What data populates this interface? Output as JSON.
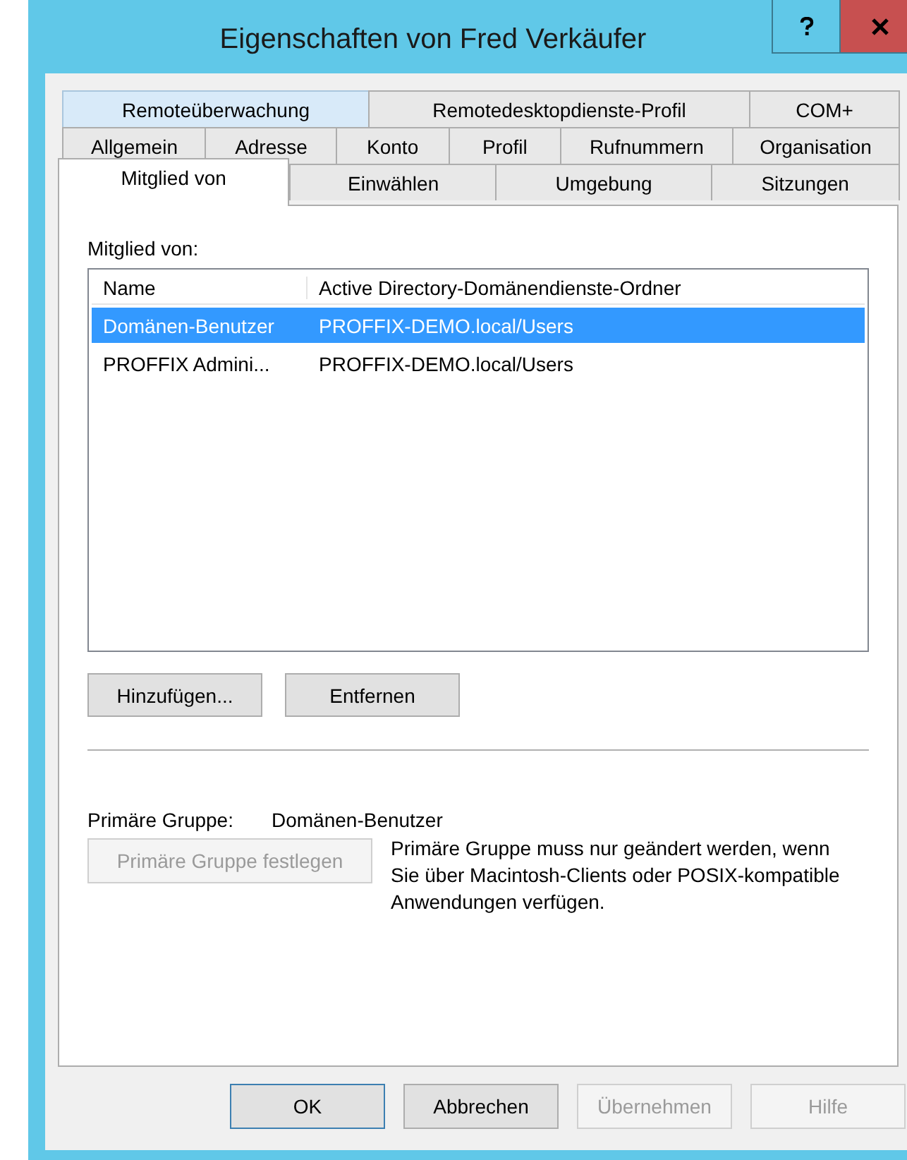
{
  "window": {
    "title": "Eigenschaften von Fred Verkäufer"
  },
  "tab_rows": [
    [
      {
        "label": "Remoteüberwachung",
        "selected": false,
        "highlighted": true
      },
      {
        "label": "Remotedesktopdienste-Profil",
        "selected": false,
        "highlighted": false
      },
      {
        "label": "COM+",
        "selected": false,
        "highlighted": false
      }
    ],
    [
      {
        "label": "Allgemein",
        "selected": false,
        "highlighted": false
      },
      {
        "label": "Adresse",
        "selected": false,
        "highlighted": false
      },
      {
        "label": "Konto",
        "selected": false,
        "highlighted": false
      },
      {
        "label": "Profil",
        "selected": false,
        "highlighted": false
      },
      {
        "label": "Rufnummern",
        "selected": false,
        "highlighted": false
      },
      {
        "label": "Organisation",
        "selected": false,
        "highlighted": false
      }
    ],
    [
      {
        "label": "Mitglied von",
        "selected": true,
        "highlighted": false
      },
      {
        "label": "Einwählen",
        "selected": false,
        "highlighted": false
      },
      {
        "label": "Umgebung",
        "selected": false,
        "highlighted": false
      },
      {
        "label": "Sitzungen",
        "selected": false,
        "highlighted": false
      }
    ]
  ],
  "member_label": "Mitglied von:",
  "table": {
    "columns": [
      "Name",
      "Active Directory-Domänendienste-Ordner"
    ],
    "rows": [
      {
        "cells": [
          "Domänen-Benutzer",
          "PROFFIX-DEMO.local/Users"
        ],
        "selected": true
      },
      {
        "cells": [
          "PROFFIX Admini...",
          "PROFFIX-DEMO.local/Users"
        ],
        "selected": false
      }
    ]
  },
  "list_buttons": [
    {
      "label": "Hinzufügen...",
      "disabled": false
    },
    {
      "label": "Entfernen",
      "disabled": false
    }
  ],
  "primary_group": {
    "label": "Primäre Gruppe:",
    "value": "Domänen-Benutzer",
    "button": {
      "label": "Primäre Gruppe festlegen",
      "disabled": true
    },
    "note": "Primäre Gruppe muss nur geändert werden, wenn Sie über Macintosh-Clients oder POSIX-kompatible Anwendungen verfügen."
  },
  "buttons": [
    {
      "label": "OK",
      "default": true,
      "disabled": false
    },
    {
      "label": "Abbrechen",
      "default": false,
      "disabled": false
    },
    {
      "label": "Übernehmen",
      "default": false,
      "disabled": true
    },
    {
      "label": "Hilfe",
      "default": false,
      "disabled": true
    }
  ]
}
